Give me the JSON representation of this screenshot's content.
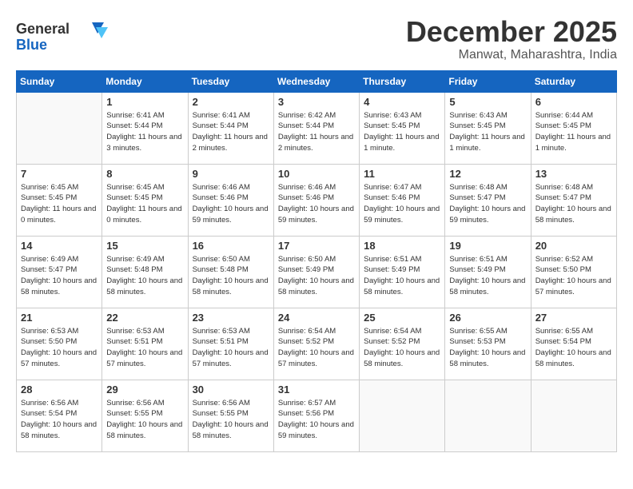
{
  "logo": {
    "general": "General",
    "blue": "Blue"
  },
  "title": "December 2025",
  "location": "Manwat, Maharashtra, India",
  "headers": [
    "Sunday",
    "Monday",
    "Tuesday",
    "Wednesday",
    "Thursday",
    "Friday",
    "Saturday"
  ],
  "weeks": [
    [
      {
        "day": "",
        "sunrise": "",
        "sunset": "",
        "daylight": ""
      },
      {
        "day": "1",
        "sunrise": "Sunrise: 6:41 AM",
        "sunset": "Sunset: 5:44 PM",
        "daylight": "Daylight: 11 hours and 3 minutes."
      },
      {
        "day": "2",
        "sunrise": "Sunrise: 6:41 AM",
        "sunset": "Sunset: 5:44 PM",
        "daylight": "Daylight: 11 hours and 2 minutes."
      },
      {
        "day": "3",
        "sunrise": "Sunrise: 6:42 AM",
        "sunset": "Sunset: 5:44 PM",
        "daylight": "Daylight: 11 hours and 2 minutes."
      },
      {
        "day": "4",
        "sunrise": "Sunrise: 6:43 AM",
        "sunset": "Sunset: 5:45 PM",
        "daylight": "Daylight: 11 hours and 1 minute."
      },
      {
        "day": "5",
        "sunrise": "Sunrise: 6:43 AM",
        "sunset": "Sunset: 5:45 PM",
        "daylight": "Daylight: 11 hours and 1 minute."
      },
      {
        "day": "6",
        "sunrise": "Sunrise: 6:44 AM",
        "sunset": "Sunset: 5:45 PM",
        "daylight": "Daylight: 11 hours and 1 minute."
      }
    ],
    [
      {
        "day": "7",
        "sunrise": "Sunrise: 6:45 AM",
        "sunset": "Sunset: 5:45 PM",
        "daylight": "Daylight: 11 hours and 0 minutes."
      },
      {
        "day": "8",
        "sunrise": "Sunrise: 6:45 AM",
        "sunset": "Sunset: 5:45 PM",
        "daylight": "Daylight: 11 hours and 0 minutes."
      },
      {
        "day": "9",
        "sunrise": "Sunrise: 6:46 AM",
        "sunset": "Sunset: 5:46 PM",
        "daylight": "Daylight: 10 hours and 59 minutes."
      },
      {
        "day": "10",
        "sunrise": "Sunrise: 6:46 AM",
        "sunset": "Sunset: 5:46 PM",
        "daylight": "Daylight: 10 hours and 59 minutes."
      },
      {
        "day": "11",
        "sunrise": "Sunrise: 6:47 AM",
        "sunset": "Sunset: 5:46 PM",
        "daylight": "Daylight: 10 hours and 59 minutes."
      },
      {
        "day": "12",
        "sunrise": "Sunrise: 6:48 AM",
        "sunset": "Sunset: 5:47 PM",
        "daylight": "Daylight: 10 hours and 59 minutes."
      },
      {
        "day": "13",
        "sunrise": "Sunrise: 6:48 AM",
        "sunset": "Sunset: 5:47 PM",
        "daylight": "Daylight: 10 hours and 58 minutes."
      }
    ],
    [
      {
        "day": "14",
        "sunrise": "Sunrise: 6:49 AM",
        "sunset": "Sunset: 5:47 PM",
        "daylight": "Daylight: 10 hours and 58 minutes."
      },
      {
        "day": "15",
        "sunrise": "Sunrise: 6:49 AM",
        "sunset": "Sunset: 5:48 PM",
        "daylight": "Daylight: 10 hours and 58 minutes."
      },
      {
        "day": "16",
        "sunrise": "Sunrise: 6:50 AM",
        "sunset": "Sunset: 5:48 PM",
        "daylight": "Daylight: 10 hours and 58 minutes."
      },
      {
        "day": "17",
        "sunrise": "Sunrise: 6:50 AM",
        "sunset": "Sunset: 5:49 PM",
        "daylight": "Daylight: 10 hours and 58 minutes."
      },
      {
        "day": "18",
        "sunrise": "Sunrise: 6:51 AM",
        "sunset": "Sunset: 5:49 PM",
        "daylight": "Daylight: 10 hours and 58 minutes."
      },
      {
        "day": "19",
        "sunrise": "Sunrise: 6:51 AM",
        "sunset": "Sunset: 5:49 PM",
        "daylight": "Daylight: 10 hours and 58 minutes."
      },
      {
        "day": "20",
        "sunrise": "Sunrise: 6:52 AM",
        "sunset": "Sunset: 5:50 PM",
        "daylight": "Daylight: 10 hours and 57 minutes."
      }
    ],
    [
      {
        "day": "21",
        "sunrise": "Sunrise: 6:53 AM",
        "sunset": "Sunset: 5:50 PM",
        "daylight": "Daylight: 10 hours and 57 minutes."
      },
      {
        "day": "22",
        "sunrise": "Sunrise: 6:53 AM",
        "sunset": "Sunset: 5:51 PM",
        "daylight": "Daylight: 10 hours and 57 minutes."
      },
      {
        "day": "23",
        "sunrise": "Sunrise: 6:53 AM",
        "sunset": "Sunset: 5:51 PM",
        "daylight": "Daylight: 10 hours and 57 minutes."
      },
      {
        "day": "24",
        "sunrise": "Sunrise: 6:54 AM",
        "sunset": "Sunset: 5:52 PM",
        "daylight": "Daylight: 10 hours and 57 minutes."
      },
      {
        "day": "25",
        "sunrise": "Sunrise: 6:54 AM",
        "sunset": "Sunset: 5:52 PM",
        "daylight": "Daylight: 10 hours and 58 minutes."
      },
      {
        "day": "26",
        "sunrise": "Sunrise: 6:55 AM",
        "sunset": "Sunset: 5:53 PM",
        "daylight": "Daylight: 10 hours and 58 minutes."
      },
      {
        "day": "27",
        "sunrise": "Sunrise: 6:55 AM",
        "sunset": "Sunset: 5:54 PM",
        "daylight": "Daylight: 10 hours and 58 minutes."
      }
    ],
    [
      {
        "day": "28",
        "sunrise": "Sunrise: 6:56 AM",
        "sunset": "Sunset: 5:54 PM",
        "daylight": "Daylight: 10 hours and 58 minutes."
      },
      {
        "day": "29",
        "sunrise": "Sunrise: 6:56 AM",
        "sunset": "Sunset: 5:55 PM",
        "daylight": "Daylight: 10 hours and 58 minutes."
      },
      {
        "day": "30",
        "sunrise": "Sunrise: 6:56 AM",
        "sunset": "Sunset: 5:55 PM",
        "daylight": "Daylight: 10 hours and 58 minutes."
      },
      {
        "day": "31",
        "sunrise": "Sunrise: 6:57 AM",
        "sunset": "Sunset: 5:56 PM",
        "daylight": "Daylight: 10 hours and 59 minutes."
      },
      {
        "day": "",
        "sunrise": "",
        "sunset": "",
        "daylight": ""
      },
      {
        "day": "",
        "sunrise": "",
        "sunset": "",
        "daylight": ""
      },
      {
        "day": "",
        "sunrise": "",
        "sunset": "",
        "daylight": ""
      }
    ]
  ]
}
